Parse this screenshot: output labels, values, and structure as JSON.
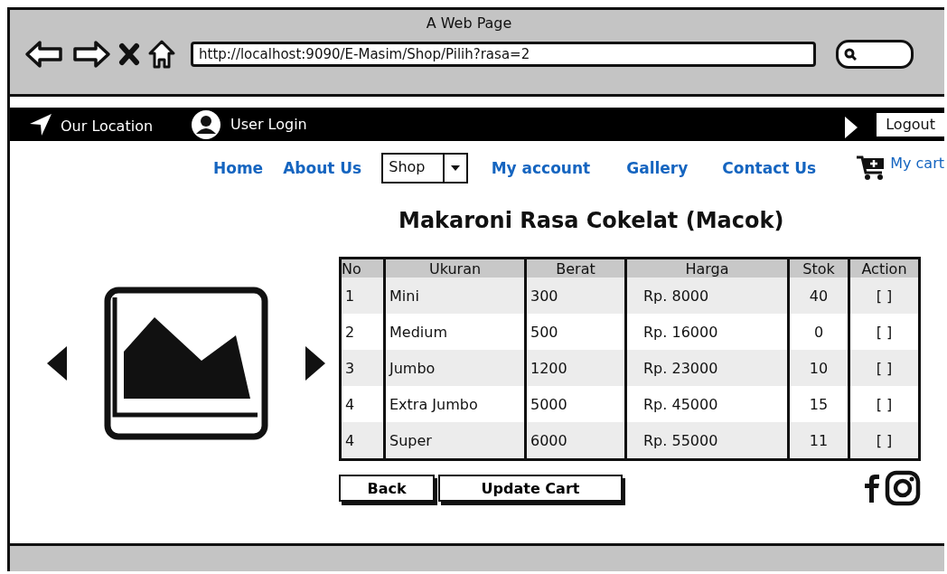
{
  "window": {
    "title": "A Web Page"
  },
  "address_bar": {
    "url": "http://localhost:9090/E-Masim/Shop/Pilih?rasa=2"
  },
  "top_bar": {
    "items": [
      {
        "kind": "location",
        "label": "Our Location"
      },
      {
        "kind": "user",
        "label": "User Login"
      }
    ],
    "logout": "Logout"
  },
  "nav": {
    "items": [
      {
        "kind": "link",
        "label": "Home"
      },
      {
        "kind": "link",
        "label": "About Us"
      },
      {
        "kind": "dropdown",
        "label": "Shop"
      },
      {
        "kind": "link",
        "label": "My account"
      },
      {
        "kind": "link",
        "label": "Gallery"
      },
      {
        "kind": "link",
        "label": "Contact Us"
      }
    ],
    "cart": "My cart"
  },
  "heading": "Makaroni Rasa Cokelat (Macok)",
  "table": {
    "columns": [
      "No",
      "Ukuran",
      "Berat",
      "Harga",
      "Stok",
      "Action"
    ],
    "rows": [
      [
        "1",
        "Mini",
        "300",
        "Rp. 8000",
        "40",
        "[ ]"
      ],
      [
        "2",
        "Medium",
        "500",
        "Rp. 16000",
        "0",
        "[ ]"
      ],
      [
        "3",
        "Jumbo",
        "1200",
        "Rp. 23000",
        "10",
        "[ ]"
      ],
      [
        "4",
        "Extra Jumbo",
        "5000",
        "Rp. 45000",
        "15",
        "[ ]"
      ],
      [
        "4",
        "Super",
        "6000",
        "Rp. 55000",
        "11",
        "[ ]"
      ]
    ]
  },
  "buttons": [
    "Back",
    "Update Cart"
  ]
}
